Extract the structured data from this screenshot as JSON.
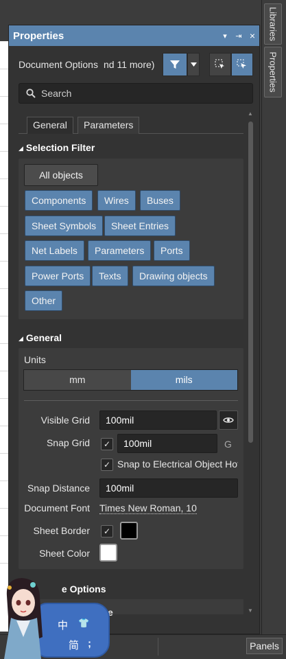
{
  "panel": {
    "title": "Properties",
    "title_buttons": [
      "▾",
      "⇥",
      "×"
    ]
  },
  "toolbar": {
    "doc_text_a": "Document Options",
    "doc_text_b": "nd 11 more)",
    "filter_icon": "filter-icon",
    "dropdown_icon": "chevron-down-icon",
    "select_icon": "select-objects-icon",
    "cursor_icon": "cursor-icon"
  },
  "search": {
    "placeholder": "Search"
  },
  "tabs": [
    "General",
    "Parameters"
  ],
  "selection_filter": {
    "heading": "Selection Filter",
    "all_objects": "All objects",
    "chips": [
      "Components",
      "Wires",
      "Buses",
      "Sheet Symbols",
      "Sheet Entries",
      "Net Labels",
      "Parameters",
      "Ports",
      "Power Ports",
      "Texts",
      "Drawing objects",
      "Other"
    ]
  },
  "general": {
    "heading": "General",
    "units_label": "Units",
    "units_mm": "mm",
    "units_mils": "mils",
    "units_selected": "mils",
    "visible_grid_label": "Visible Grid",
    "visible_grid_value": "100mil",
    "snap_grid_label": "Snap Grid",
    "snap_grid_value": "100mil",
    "snap_grid_shortcut": "G",
    "snap_electrical_label": "Snap to Electrical Object Hots",
    "snap_distance_label": "Snap Distance",
    "snap_distance_value": "100mil",
    "document_font_label": "Document Font",
    "document_font_value": "Times New Roman, 10",
    "sheet_border_label": "Sheet Border",
    "sheet_border_checked": true,
    "sheet_border_color": "#000000",
    "sheet_color_label": "Sheet Color",
    "sheet_color": "#ffffff"
  },
  "sheet_options": {
    "heading_partial": "e Options",
    "row_partial": "e"
  },
  "right_strip": {
    "tab1": "Libraries",
    "tab2": "Properties"
  },
  "status": {
    "panels": "Panels"
  },
  "ime": {
    "char1": "中",
    "char2": "简"
  },
  "colors": {
    "accent": "#5b84ae",
    "panel_bg": "#333333",
    "field_bg": "#262626"
  }
}
